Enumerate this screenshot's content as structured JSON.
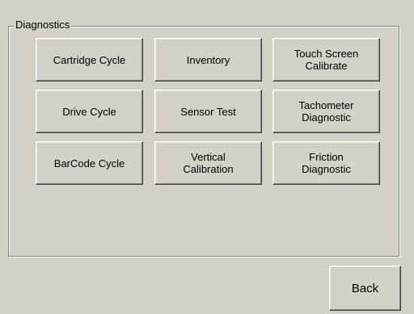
{
  "groupbox": {
    "title": "Diagnostics"
  },
  "buttons": {
    "cartridge_cycle": "Cartridge Cycle",
    "inventory": "Inventory",
    "touch_screen_calibrate": "Touch Screen\nCalibrate",
    "drive_cycle": "Drive Cycle",
    "sensor_test": "Sensor Test",
    "tachometer_diagnostic": "Tachometer\nDiagnostic",
    "barcode_cycle": "BarCode Cycle",
    "vertical_calibration": "Vertical\nCalibration",
    "friction_diagnostic": "Friction\nDiagnostic"
  },
  "footer": {
    "back_label": "Back"
  }
}
